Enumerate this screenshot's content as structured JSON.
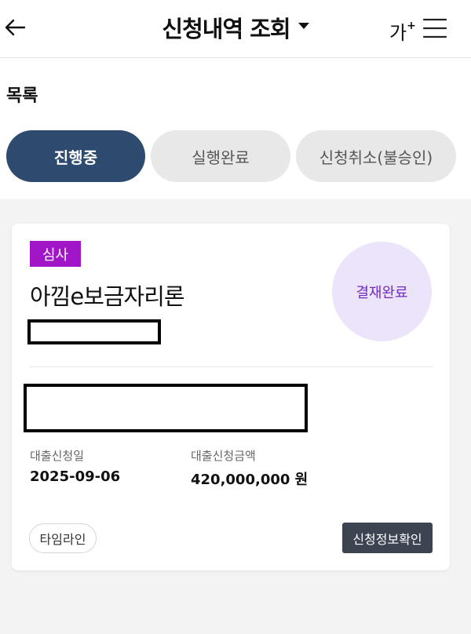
{
  "header": {
    "title": "신청내역 조회",
    "font_size_label": "가",
    "font_size_plus": "+",
    "icons": {
      "back": "arrow-left-icon",
      "dropdown": "caret-down-icon",
      "menu": "hamburger-menu-icon"
    }
  },
  "section": {
    "title": "목록"
  },
  "tabs": [
    {
      "label": "진행중",
      "active": true
    },
    {
      "label": "실행완료",
      "active": false
    },
    {
      "label": "신청취소(불승인)",
      "active": false
    }
  ],
  "card": {
    "badge": "심사",
    "product_name": "아낌e보금자리론",
    "status": "결재완료",
    "fields": {
      "date_label": "대출신청일",
      "date_value": "2025-09-06",
      "amount_label": "대출신청금액",
      "amount_value": "420,000,000 원"
    },
    "buttons": {
      "timeline": "타임라인",
      "confirm": "신청정보확인"
    }
  },
  "colors": {
    "active_tab": "#2e4a6e",
    "inactive_tab": "#e8e8e8",
    "badge": "#a117c7",
    "status_circle_bg": "#ece4fa",
    "status_circle_text": "#6f2bbd",
    "confirm_button": "#3d4451",
    "background_gray": "#f3f3f3"
  }
}
